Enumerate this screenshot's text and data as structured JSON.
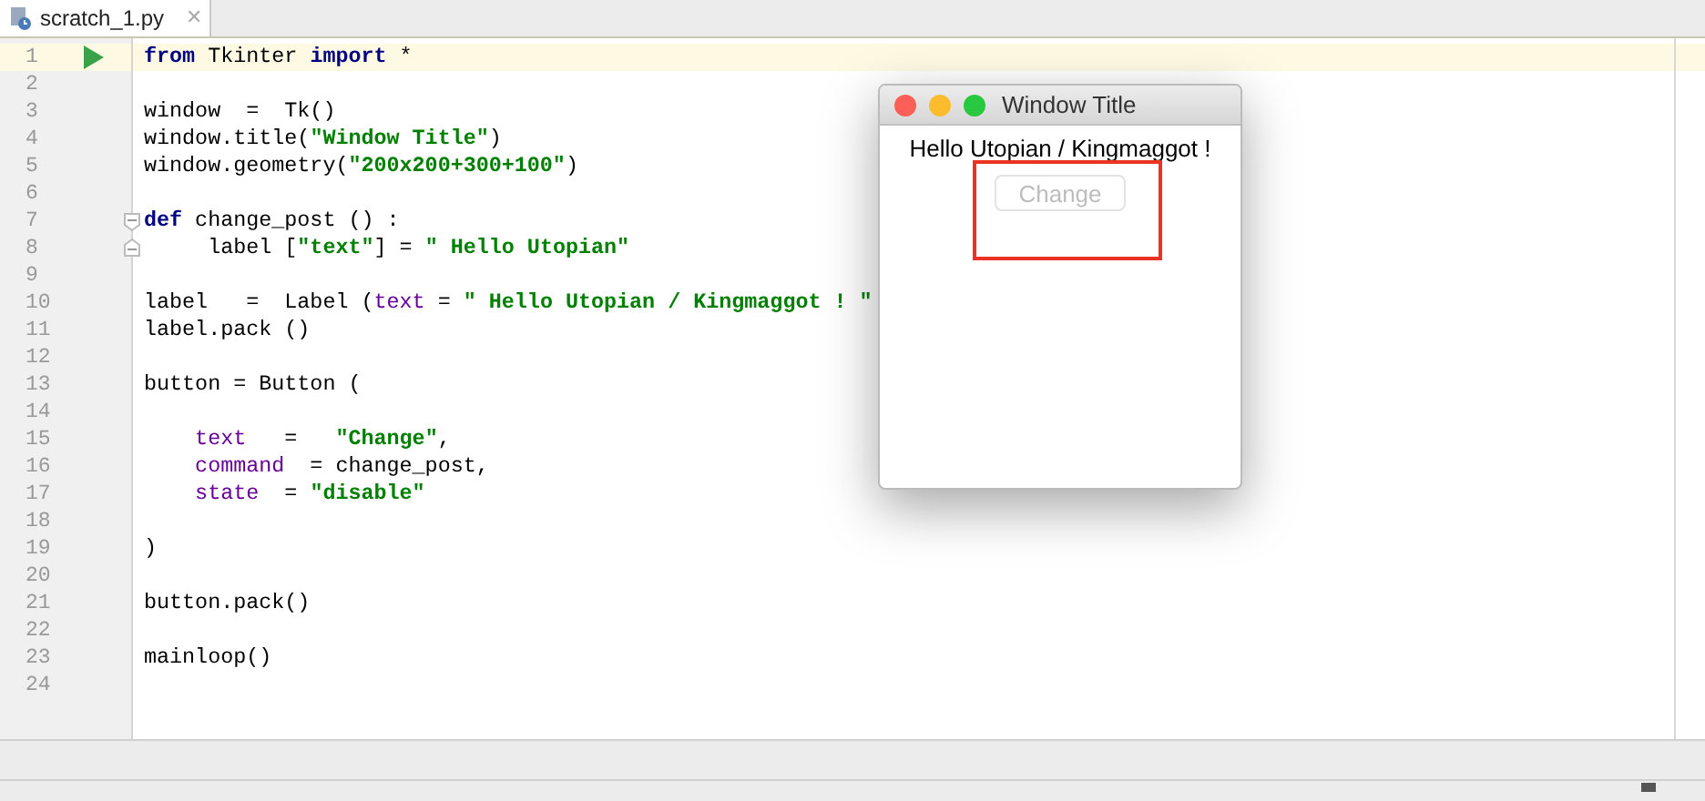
{
  "tab": {
    "label": "scratch_1.py",
    "selected": true,
    "close": "✕"
  },
  "editor": {
    "lines": [
      {
        "number": "1",
        "current": true,
        "run_marker": true,
        "tokens": [
          {
            "kind": "keyword",
            "text": "from"
          },
          {
            "kind": "plain",
            "text": " Tkinter "
          },
          {
            "kind": "keyword",
            "text": "import"
          },
          {
            "kind": "plain",
            "text": " *"
          }
        ]
      },
      {
        "number": "2",
        "current": false,
        "run_marker": false
      },
      {
        "number": "3",
        "current": false,
        "run_marker": false,
        "tokens": [
          {
            "kind": "plain",
            "text": "window  =  Tk()"
          }
        ]
      },
      {
        "number": "4",
        "current": false,
        "run_marker": false,
        "tokens": [
          {
            "kind": "plain",
            "text": "window.title("
          },
          {
            "kind": "string",
            "text": "\"Window Title\""
          },
          {
            "kind": "plain",
            "text": ")"
          }
        ]
      },
      {
        "number": "5",
        "current": false,
        "run_marker": false,
        "tokens": [
          {
            "kind": "plain",
            "text": "window.geometry("
          },
          {
            "kind": "string",
            "text": "\"200x200+300+100\""
          },
          {
            "kind": "plain",
            "text": ")"
          }
        ]
      },
      {
        "number": "6",
        "current": false,
        "run_marker": false
      },
      {
        "number": "7",
        "current": false,
        "run_marker": false,
        "fold_start": true,
        "tokens": [
          {
            "kind": "keyword",
            "text": "def"
          },
          {
            "kind": "plain",
            "text": " change_post () :"
          }
        ]
      },
      {
        "number": "8",
        "current": false,
        "run_marker": false,
        "fold_end": true,
        "tokens": [
          {
            "kind": "plain",
            "text": "     label ["
          },
          {
            "kind": "string",
            "text": "\"text\""
          },
          {
            "kind": "plain",
            "text": "] = "
          },
          {
            "kind": "string",
            "text": "\" Hello Utopian\""
          }
        ]
      },
      {
        "number": "9",
        "current": false,
        "run_marker": false
      },
      {
        "number": "10",
        "current": false,
        "run_marker": false,
        "tokens": [
          {
            "kind": "plain",
            "text": "label   =  Label ("
          },
          {
            "kind": "param",
            "text": "text"
          },
          {
            "kind": "plain",
            "text": " = "
          },
          {
            "kind": "string",
            "text": "\" Hello Utopian / Kingmaggot ! \""
          }
        ]
      },
      {
        "number": "11",
        "current": false,
        "run_marker": false,
        "tokens": [
          {
            "kind": "plain",
            "text": "label.pack ()"
          }
        ]
      },
      {
        "number": "12",
        "current": false,
        "run_marker": false
      },
      {
        "number": "13",
        "current": false,
        "run_marker": false,
        "tokens": [
          {
            "kind": "plain",
            "text": "button = Button ("
          }
        ]
      },
      {
        "number": "14",
        "current": false,
        "run_marker": false
      },
      {
        "number": "15",
        "current": false,
        "run_marker": false,
        "tokens": [
          {
            "kind": "param",
            "text": "    text"
          },
          {
            "kind": "plain",
            "text": "   =   "
          },
          {
            "kind": "string",
            "text": "\"Change\""
          },
          {
            "kind": "plain",
            "text": ","
          }
        ]
      },
      {
        "number": "16",
        "current": false,
        "run_marker": false,
        "tokens": [
          {
            "kind": "param",
            "text": "    command"
          },
          {
            "kind": "plain",
            "text": "  = change_post,"
          }
        ]
      },
      {
        "number": "17",
        "current": false,
        "run_marker": false,
        "tokens": [
          {
            "kind": "param",
            "text": "    state"
          },
          {
            "kind": "plain",
            "text": "  = "
          },
          {
            "kind": "string",
            "text": "\"disable\""
          }
        ]
      },
      {
        "number": "18",
        "current": false,
        "run_marker": false
      },
      {
        "number": "19",
        "current": false,
        "run_marker": false,
        "tokens": [
          {
            "kind": "plain",
            "text": ")"
          }
        ]
      },
      {
        "number": "20",
        "current": false,
        "run_marker": false
      },
      {
        "number": "21",
        "current": false,
        "run_marker": false,
        "tokens": [
          {
            "kind": "plain",
            "text": "button.pack()"
          }
        ]
      },
      {
        "number": "22",
        "current": false,
        "run_marker": false
      },
      {
        "number": "23",
        "current": false,
        "run_marker": false,
        "tokens": [
          {
            "kind": "plain",
            "text": "mainloop()"
          }
        ]
      },
      {
        "number": "24",
        "current": false,
        "run_marker": false
      }
    ]
  },
  "tk_window": {
    "title": "Window Title",
    "label": "Hello Utopian / Kingmaggot !",
    "button": {
      "label": "Change",
      "disabled": true
    },
    "highlighted": true
  }
}
